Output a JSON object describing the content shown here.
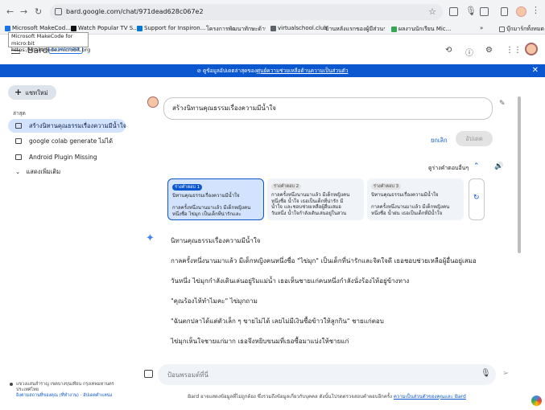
{
  "browser": {
    "url": "bard.google.com/chat/971dead628c067e2",
    "bookmarks": [
      {
        "label": "Microsoft MakeCod...",
        "color": "#1a73e8"
      },
      {
        "label": "Watch Popular TV S...",
        "color": "#111111"
      },
      {
        "label": "Support for Inspiron...",
        "color": "#0078d4"
      },
      {
        "label": "โครงการพัฒนาทักษะด้านดิจิทัลสำ...",
        "color": "#ea4335"
      },
      {
        "label": "virtualschool.club",
        "color": "#5f6368"
      },
      {
        "label": "บ้านหลังแรกของผู้มีส่วนร่วมทุกสภาพ...",
        "color": "#fbbc04"
      },
      {
        "label": "ผลงานนักเรียน Mic...",
        "color": "#34a853"
      },
      {
        "label": "บุ๊กมาร์กทั้งหมด",
        "color": "#5f6368"
      }
    ],
    "tooltip": {
      "line1": "Microsoft MakeCode for micro:bit",
      "line2": "https://makecode.microbit.org"
    }
  },
  "app": {
    "brand": "Bard",
    "badge": "Experiment",
    "banner": "ดูข้อมูลอัปเดตล่าสุดของ",
    "banner_link": "ศูนย์ความช่วยเหลือด้านความเป็นส่วนตัว"
  },
  "sidebar": {
    "new_chat": "แชทใหม่",
    "recent_label": "ล่าสุด",
    "items": [
      {
        "label": "สร้างนิทานคุณธรรมเรื่องความมีน้ำใจ"
      },
      {
        "label": "google colab generate ไม่ได้"
      },
      {
        "label": "Android Plugin Missing"
      }
    ],
    "show_more": "แสดงเพิ่มเติม",
    "location_line1": "แขวงแสนสำราญ เขตบางขุนเทียน กรุงเทพมหานคร",
    "location_line2": "ประเทศไทย",
    "location_link1": "อิงตามสถานที่ของคุณ (ที่ทำงาน)",
    "location_link2": "อัปเดตตำแหน่ง"
  },
  "main": {
    "prompt": "สร้างนิทานคุณธรรมเรื่องความมีน้ำใจ",
    "cancel": "ยกเลิก",
    "update": "อัปเดต",
    "other_drafts": "ดูร่างคำตอบอื่นๆ",
    "drafts": [
      {
        "label": "ร่างคำตอบ 1",
        "line1": "นิทานคุณธรรมเรื่องความมีน้ำใจ",
        "line2": "",
        "line3": "กาลครั้งหนึ่งนานมาแล้ว มีเด็กหญิงคน",
        "line4": "หนึ่งชื่อ ไข่มุก เป็นเด็กที่น่ารักและ"
      },
      {
        "label": "ร่างคำตอบ 2",
        "line1": "กาลครั้งหนึ่งนานมาแล้ว มีเด็กหญิงคน",
        "line2": "หนึ่งชื่อ น้ำใจ เธอเป็นเด็กที่น่ารัก มี",
        "line3": "น้ำใจ และชอบช่วยเหลือผู้อื่นเสมอ",
        "line4": "วันหนึ่ง น้ำใจกำลังเดินเล่นอยู่ในสวน"
      },
      {
        "label": "ร่างคำตอบ 3",
        "line1": "นิทานคุณธรรมเรื่องความมีน้ำใจ",
        "line2": "",
        "line3": "กาลครั้งหนึ่งนานมาแล้ว มีเด็กหญิงคน",
        "line4": "หนึ่งชื่อ น้ำฝน เธอเป็นเด็กที่มีน้ำใจ"
      }
    ],
    "response": [
      "นิทานคุณธรรมเรื่องความมีน้ำใจ",
      "กาลครั้งหนึ่งนานมาแล้ว มีเด็กหญิงคนหนึ่งชื่อ \"ไข่มุก\" เป็นเด็กที่น่ารักและจิตใจดี เธอชอบช่วยเหลือผู้อื่นอยู่เสมอ",
      "วันหนึ่ง ไข่มุกกำลังเดินเล่นอยู่ริมแม่น้ำ เธอเห็นชายแก่คนหนึ่งกำลังนั่งร้องไห้อยู่ข้างทาง",
      "\"คุณร้องไห้ทำไมคะ\" ไข่มุกถาม",
      "\"ฉันตกปลาได้แต่ตัวเล็ก ๆ ขายไม่ได้ เลยไม่มีเงินซื้อข้าวให้ลูกกิน\" ชายแก่ตอบ",
      "ไข่มุกเห็นใจชายแก่มาก เธอจึงหยิบขนมที่เธอซื้อมาแบ่งให้ชายแก่"
    ]
  },
  "input": {
    "placeholder": "ป้อนพรอมต์ที่นี่"
  },
  "disclaimer": {
    "text": "Bard อาจแสดงข้อมูลที่ไม่ถูกต้อง ซึ่งรวมถึงข้อมูลเกี่ยวกับบุคคล ดังนั้นโปรดตรวจสอบคำตอบอีกครั้ง",
    "link": "ความเป็นส่วนตัวของคุณและ Bard"
  }
}
